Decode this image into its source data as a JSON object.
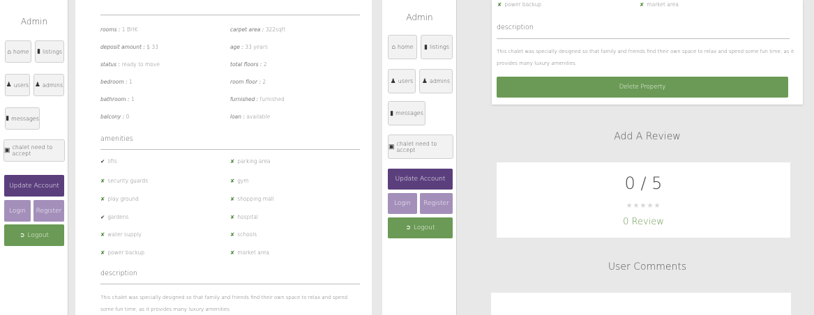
{
  "sidebar": {
    "admin_title": "Admin",
    "home": "home",
    "listings": "listings",
    "users": "users",
    "admins": "admins",
    "messages": "messages",
    "chalet_accept": "chalet need to accept",
    "update_account": "Update Account",
    "login": "Login",
    "register": "Register",
    "logout": "Logout"
  },
  "details": {
    "rooms_label": "rooms :",
    "rooms_value": "1 BHK",
    "carpet_label": "carpet area :",
    "carpet_value": "322sqft",
    "deposit_label": "deposit amount :",
    "deposit_value": "$ 33",
    "age_label": "age :",
    "age_value": "33 years",
    "status_label": "status :",
    "status_value": "ready to move",
    "floors_label": "total floors :",
    "floors_value": "2",
    "bedroom_label": "bedroom :",
    "bedroom_value": "1",
    "roomfloor_label": "room floor :",
    "roomfloor_value": "2",
    "bathroom_label": "bathroom :",
    "bathroom_value": "1",
    "furnished_label": "furnished :",
    "furnished_value": "furnished",
    "balcony_label": "balcony :",
    "balcony_value": "0",
    "loan_label": "loan :",
    "loan_value": "available"
  },
  "amenities_heading": "amenities",
  "amenities": {
    "lifts": "lifts",
    "parking": "parking area",
    "security": "security guards",
    "gym": "gym",
    "play": "play ground",
    "mall": "shopping mall",
    "gardens": "gardens",
    "hospital": "hospital",
    "water": "water supply",
    "schools": "schools",
    "power": "power backup",
    "market": "market area"
  },
  "description_heading": "description",
  "description_text": "This chalet was specially designed so that family and friends find their own space to relax and spend some fun time, as it provides many luxury amenities.",
  "right": {
    "power_partial": "power backup",
    "market_partial": "market area",
    "description_heading": "description",
    "description_text": "This chalet was specially designed so that family and friends find their own space to relax and spend some fun time, as it provides many luxury amenities.",
    "delete_button": "Delete Property",
    "add_review": "Add A Review",
    "score": "0 / 5",
    "stars": "★★★★★",
    "review_count": "0 Review",
    "user_comments": "User Comments"
  },
  "icons": {
    "home": "home-icon",
    "listings": "building-icon",
    "users": "user-icon",
    "admins": "users-icon",
    "messages": "envelope-icon",
    "chalet": "building-check-icon",
    "logout": "sign-out-icon",
    "check": "check-icon",
    "cross": "cross-icon"
  },
  "colors": {
    "purple": "#5b3f7d",
    "lilac": "#a48fba",
    "green": "#6a9a55"
  }
}
